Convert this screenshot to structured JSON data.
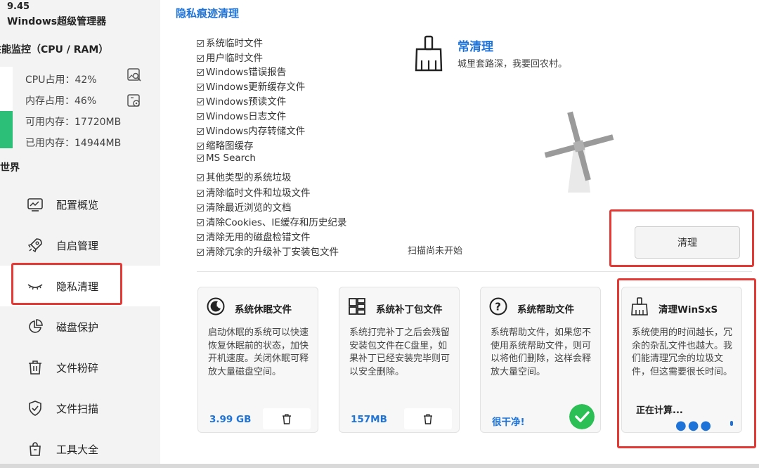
{
  "app": {
    "version": "9.45",
    "name": "Windows超级管理器"
  },
  "sidebar": {
    "perf_title": "性能监控（CPU / RAM）",
    "cpu": "CPU占用：42%",
    "mem": "内存占用：46%",
    "avail": "可用内存：17720MB",
    "used": "已用内存：14944MB",
    "cpu_percent": 42,
    "mem_percent": 46,
    "section_world": "世界",
    "items": [
      {
        "label": "配置概览"
      },
      {
        "label": "自启管理"
      },
      {
        "label": "隐私清理"
      },
      {
        "label": "磁盘保护"
      },
      {
        "label": "文件粉碎"
      },
      {
        "label": "文件扫描"
      },
      {
        "label": "工具大全"
      }
    ]
  },
  "main": {
    "title": "隐私痕迹清理",
    "checklist": [
      "系统临时文件",
      "用户临时文件",
      "Windows错误报告",
      "Windows更新缓存文件",
      "Windows预读文件",
      "Windows日志文件",
      "Windows内存转储文件",
      "缩略图缓存",
      "MS Search",
      "其他类型的系统垃圾",
      "清除临时文件和垃圾文件",
      "清除最近浏览的文档",
      "清除Cookies、IE缓存和历史纪录",
      "清除无用的磁盘检错文件",
      "清除冗余的升级补丁安装包文件"
    ],
    "clean_head": "常清理",
    "clean_sub": "城里套路深，我要回农村。",
    "scan_status": "扫描尚未开始",
    "clean_button": "清理"
  },
  "cards": [
    {
      "title": "系统休眠文件",
      "desc": "启动休眠的系统可以快速恢复休眠前的状态，加快开机速度。关闭休眠可释放大量磁盘空间。",
      "size": "3.99 GB"
    },
    {
      "title": "系统补丁包文件",
      "desc": "系统打完补丁之后会残留安装包文件在C盘里，如果补丁已经安装完毕则可以安全删除。",
      "size": "157MB"
    },
    {
      "title": "系统帮助文件",
      "desc": "系统帮助文件，如果您不使用系统帮助文件，则可以将他们删除，这样会释放大量空间。",
      "size": "很干净!"
    },
    {
      "title": "清理WinSxS",
      "desc": "系统使用的时间越长，冗余的杂乱文件也越大。我们能清理冗余的垃圾文件，但这需要很长时间。",
      "status": "正在计算..."
    }
  ],
  "colors": {
    "accent": "#1e73d9",
    "success": "#2bbf55",
    "highlight": "#e53935"
  }
}
